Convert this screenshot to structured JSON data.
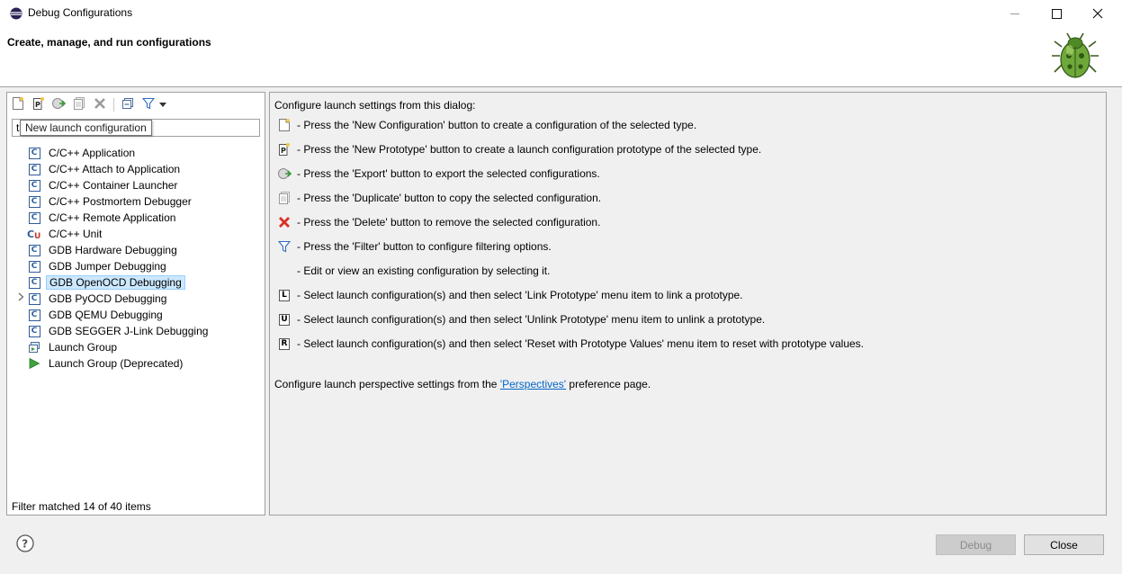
{
  "window": {
    "title": "Debug Configurations",
    "controls": {
      "minimize": "minimize",
      "maximize": "maximize",
      "close": "close"
    }
  },
  "banner": {
    "title": "Create, manage, and run configurations",
    "icon": "bug-icon"
  },
  "left": {
    "toolbar": [
      {
        "name": "new-configuration-button",
        "icon": "new-config-icon"
      },
      {
        "name": "new-prototype-button",
        "icon": "new-prototype-icon"
      },
      {
        "name": "export-button",
        "icon": "export-icon"
      },
      {
        "name": "duplicate-button",
        "icon": "duplicate-icon"
      },
      {
        "name": "delete-button",
        "icon": "delete-icon"
      },
      {
        "name": "collapse-all-button",
        "icon": "collapse-all-icon"
      },
      {
        "name": "filter-button",
        "icon": "filter-icon"
      },
      {
        "name": "filter-menu-button",
        "icon": "chevron-down-icon"
      }
    ],
    "filter_value": "t",
    "tooltip": "New launch configuration",
    "items": [
      {
        "label": "C/C++ Application",
        "icon": "c-app-icon"
      },
      {
        "label": "C/C++ Attach to Application",
        "icon": "c-app-icon"
      },
      {
        "label": "C/C++ Container Launcher",
        "icon": "c-app-icon"
      },
      {
        "label": "C/C++ Postmortem Debugger",
        "icon": "c-app-icon"
      },
      {
        "label": "C/C++ Remote Application",
        "icon": "c-app-icon"
      },
      {
        "label": "C/C++ Unit",
        "icon": "c-unit-icon"
      },
      {
        "label": "GDB Hardware Debugging",
        "icon": "c-app-icon",
        "expandable": true
      },
      {
        "label": "GDB Jumper Debugging",
        "icon": "c-app-icon"
      },
      {
        "label": "GDB OpenOCD Debugging",
        "icon": "c-app-icon",
        "selected": true
      },
      {
        "label": "GDB PyOCD Debugging",
        "icon": "c-app-icon"
      },
      {
        "label": "GDB QEMU Debugging",
        "icon": "c-app-icon"
      },
      {
        "label": "GDB SEGGER J-Link Debugging",
        "icon": "c-app-icon"
      },
      {
        "label": "Launch Group",
        "icon": "launch-group-icon"
      },
      {
        "label": "Launch Group (Deprecated)",
        "icon": "run-icon"
      }
    ],
    "status": "Filter matched 14 of 40 items"
  },
  "right": {
    "intro": "Configure launch settings from this dialog:",
    "rows": [
      {
        "icon": "new-config-icon",
        "text": "- Press the 'New Configuration' button to create a configuration of the selected type."
      },
      {
        "icon": "new-prototype-icon",
        "text": "- Press the 'New Prototype' button to create a launch configuration prototype of the selected type."
      },
      {
        "icon": "export-icon",
        "text": "- Press the 'Export' button to export the selected configurations."
      },
      {
        "icon": "duplicate-icon",
        "text": "- Press the 'Duplicate' button to copy the selected configuration."
      },
      {
        "icon": "delete-icon",
        "text": "- Press the 'Delete' button to remove the selected configuration."
      },
      {
        "icon": "filter-icon",
        "text": "- Press the 'Filter' button to configure filtering options."
      },
      {
        "icon": "",
        "text": "- Edit or view an existing configuration by selecting it."
      },
      {
        "icon": "link-prototype-icon",
        "text": "- Select launch configuration(s) and then select 'Link Prototype' menu item to link a prototype."
      },
      {
        "icon": "unlink-prototype-icon",
        "text": "- Select launch configuration(s) and then select 'Unlink Prototype' menu item to unlink a prototype."
      },
      {
        "icon": "reset-prototype-icon",
        "text": "- Select launch configuration(s) and then select 'Reset with Prototype Values' menu item to reset with prototype values."
      }
    ],
    "perspectives_prefix": "Configure launch perspective settings from the ",
    "perspectives_link": "'Perspectives'",
    "perspectives_suffix": " preference page."
  },
  "footer": {
    "debug_label": "Debug",
    "close_label": "Close"
  }
}
